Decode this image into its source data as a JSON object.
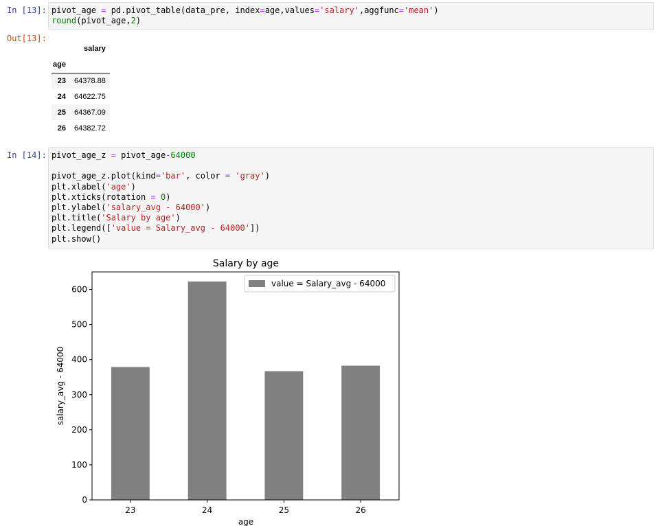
{
  "cell13": {
    "in_prompt": "In [13]:",
    "out_prompt": "Out[13]:",
    "code": [
      [
        [
          "pivot_age ",
          ""
        ],
        [
          "=",
          "op"
        ],
        [
          " pd.pivot_table(data_pre, index",
          ""
        ],
        [
          "=",
          "op"
        ],
        [
          "age,values",
          ""
        ],
        [
          "=",
          "op"
        ],
        [
          "'salary'",
          "str"
        ],
        [
          ",aggfunc",
          ""
        ],
        [
          "=",
          "op"
        ],
        [
          "'mean'",
          "str"
        ],
        [
          ")",
          ""
        ]
      ],
      [
        [
          "round",
          "kw"
        ],
        [
          "(pivot_age,",
          ""
        ],
        [
          "2",
          "num"
        ],
        [
          ")",
          ""
        ]
      ]
    ],
    "table": {
      "column_header": "salary",
      "index_name": "age",
      "rows": [
        {
          "age": "23",
          "salary": "64378.88"
        },
        {
          "age": "24",
          "salary": "64622.75"
        },
        {
          "age": "25",
          "salary": "64367.09"
        },
        {
          "age": "26",
          "salary": "64382.72"
        }
      ]
    }
  },
  "cell14": {
    "in_prompt": "In [14]:",
    "code": [
      [
        [
          "pivot_age_z ",
          ""
        ],
        [
          "=",
          "op"
        ],
        [
          " pivot_age",
          ""
        ],
        [
          "-",
          "op"
        ],
        [
          "64000",
          "num"
        ]
      ],
      [
        [
          "",
          ""
        ]
      ],
      [
        [
          "pivot_age_z.plot(kind",
          ""
        ],
        [
          "=",
          "op"
        ],
        [
          "'bar'",
          "str"
        ],
        [
          ", color ",
          ""
        ],
        [
          "=",
          "op"
        ],
        [
          " ",
          ""
        ],
        [
          "'gray'",
          "str"
        ],
        [
          ")",
          ""
        ]
      ],
      [
        [
          "plt.xlabel(",
          ""
        ],
        [
          "'age'",
          "str"
        ],
        [
          ")",
          ""
        ]
      ],
      [
        [
          "plt.xticks(rotation ",
          ""
        ],
        [
          "=",
          "op"
        ],
        [
          " ",
          ""
        ],
        [
          "0",
          "num"
        ],
        [
          ")",
          ""
        ]
      ],
      [
        [
          "plt.ylabel(",
          ""
        ],
        [
          "'salary_avg - 64000'",
          "str"
        ],
        [
          ")",
          ""
        ]
      ],
      [
        [
          "plt.title(",
          ""
        ],
        [
          "'Salary by age'",
          "str"
        ],
        [
          ")",
          ""
        ]
      ],
      [
        [
          "plt.legend([",
          ""
        ],
        [
          "'value = Salary_avg - 64000'",
          "str"
        ],
        [
          "])",
          ""
        ]
      ],
      [
        [
          "plt.show()",
          ""
        ]
      ]
    ]
  },
  "chart_data": {
    "type": "bar",
    "title": "Salary by age",
    "xlabel": "age",
    "ylabel": "salary_avg - 64000",
    "categories": [
      "23",
      "24",
      "25",
      "26"
    ],
    "series": [
      {
        "name": "value = Salary_avg - 64000",
        "values": [
          378.88,
          622.75,
          367.09,
          382.72
        ],
        "color": "#808080"
      }
    ],
    "ylim": [
      0,
      650
    ],
    "yticks": [
      0,
      100,
      200,
      300,
      400,
      500,
      600
    ],
    "grid": false,
    "legend_position": "top-right"
  }
}
